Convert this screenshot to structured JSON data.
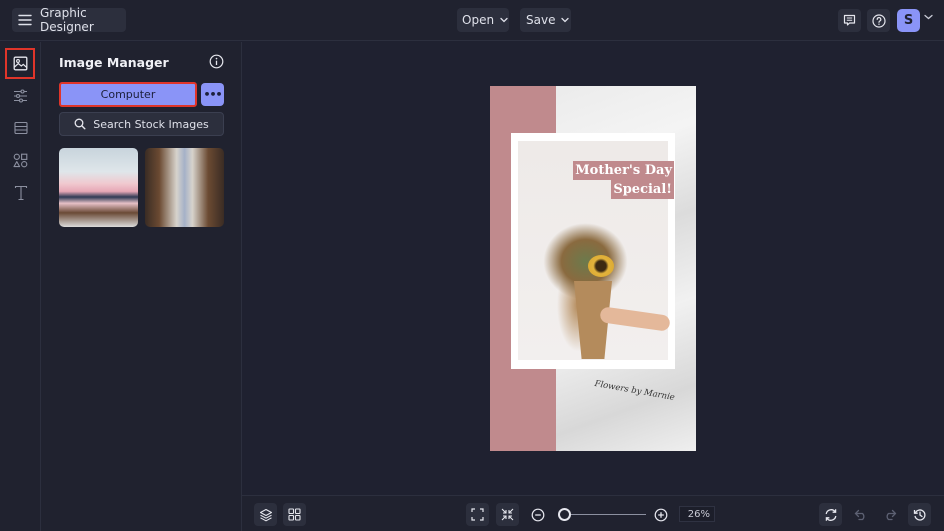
{
  "topbar": {
    "app_title": "Graphic Designer",
    "open_label": "Open",
    "save_label": "Save",
    "avatar_initial": "S"
  },
  "rail": {
    "items": [
      {
        "name": "image-manager",
        "icon": "image-icon",
        "active": true
      },
      {
        "name": "adjustments",
        "icon": "sliders-icon",
        "active": false
      },
      {
        "name": "layouts",
        "icon": "layout-icon",
        "active": false
      },
      {
        "name": "graphics",
        "icon": "shapes-icon",
        "active": false
      },
      {
        "name": "text",
        "icon": "text-icon",
        "active": false
      }
    ]
  },
  "panel": {
    "title": "Image Manager",
    "computer_label": "Computer",
    "more_label": "•••",
    "search_label": "Search Stock Images",
    "thumbnails": [
      {
        "description": "Two women lying upside down with pink legs up"
      },
      {
        "description": "Two curly-haired women facing each other holding flowers"
      }
    ]
  },
  "design": {
    "headline_line1": "Mother's Day",
    "headline_line2": "Special!",
    "signature": "Flowers by Marnie",
    "accent_color": "#c08a8d"
  },
  "bottombar": {
    "zoom_level": "26%",
    "zoom_fraction": 0.05
  },
  "colors": {
    "accent": "#8a94f7",
    "highlight": "#e0352a",
    "background": "#1f2130"
  }
}
